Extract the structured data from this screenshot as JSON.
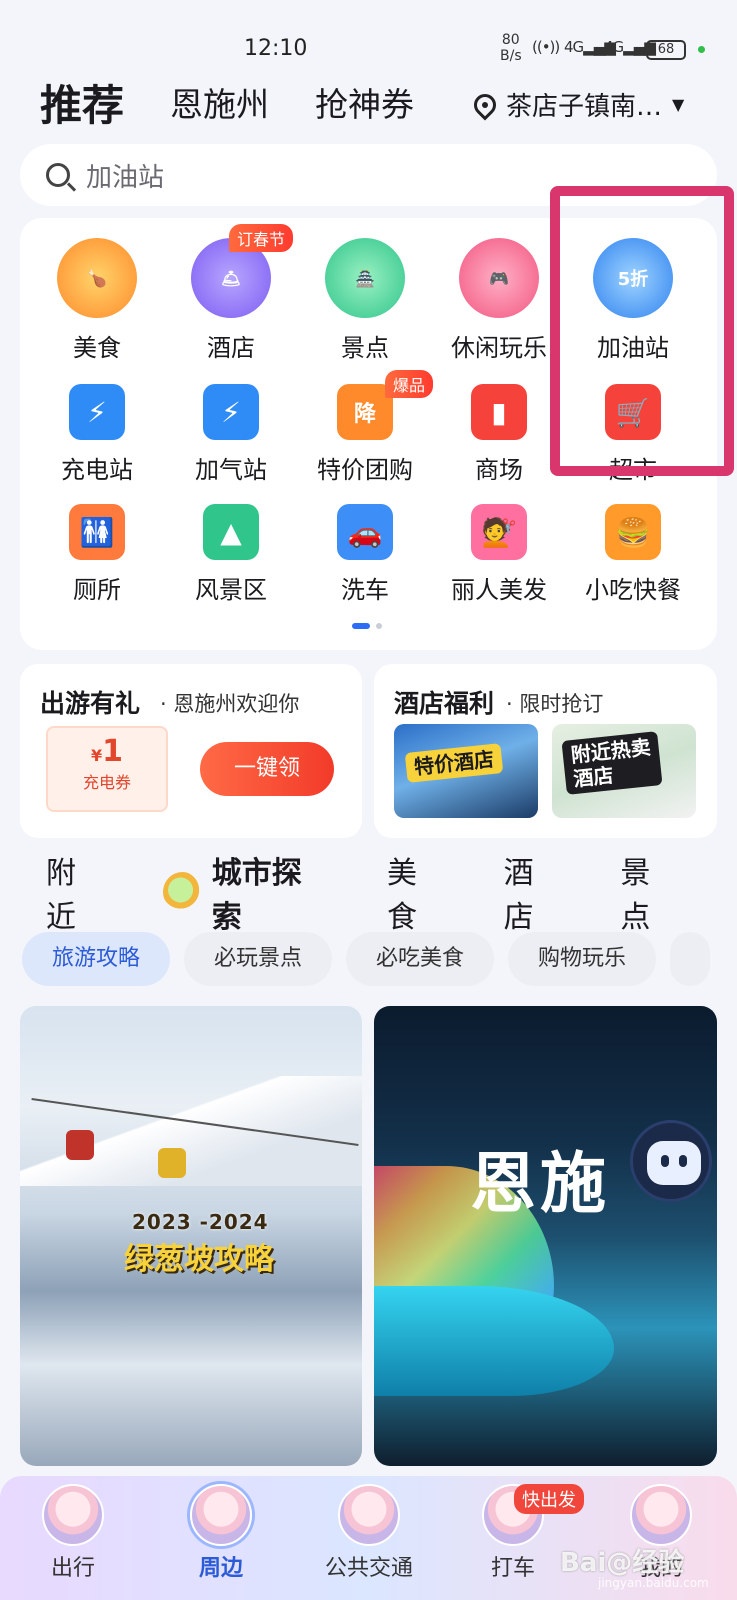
{
  "status_bar": {
    "time": "12:10",
    "speed": "80\nB/s",
    "battery": "68",
    "signal1": "4G",
    "signal2": "4G"
  },
  "header": {
    "tabs": [
      "推荐",
      "恩施州",
      "抢神券"
    ],
    "location": "茶店子镇南…"
  },
  "search": {
    "placeholder": "加油站"
  },
  "categories": [
    {
      "label": "美食"
    },
    {
      "label": "酒店",
      "tag": "订春节"
    },
    {
      "label": "景点"
    },
    {
      "label": "休闲玩乐"
    },
    {
      "label": "加油站",
      "icon_text": "5折"
    },
    {
      "label": "充电站"
    },
    {
      "label": "加气站"
    },
    {
      "label": "特价团购",
      "tag": "爆品",
      "icon_text": "降"
    },
    {
      "label": "商场"
    },
    {
      "label": "超市"
    },
    {
      "label": "厕所"
    },
    {
      "label": "风景区"
    },
    {
      "label": "洗车"
    },
    {
      "label": "丽人美发"
    },
    {
      "label": "小吃快餐"
    }
  ],
  "promo_travel": {
    "title": "出游有礼",
    "subtitle": "· 恩施州欢迎你",
    "coupon_symbol": "¥",
    "coupon_amount": "1",
    "coupon_name": "充电券",
    "button": "一键领"
  },
  "promo_hotel": {
    "title": "酒店福利",
    "subtitle": "· 限时抢订",
    "img1": "特价酒店",
    "img2": "附近热卖\n酒店"
  },
  "section_tabs": [
    "附近",
    "城市探索",
    "美食",
    "酒店",
    "景点"
  ],
  "chips": [
    "旅游攻略",
    "必玩景点",
    "必吃美食",
    "购物玩乐"
  ],
  "feed": [
    {
      "year": "2023 -2024",
      "title": "绿葱坡攻略"
    },
    {
      "title": "恩施"
    }
  ],
  "bottom_nav": [
    "出行",
    "周边",
    "公共交通",
    "打车",
    "我的"
  ],
  "bottom_badge": "快出发",
  "watermark": "Bai@经验",
  "watermark_url": "jingyan.baidu.com",
  "colors": {
    "accent": "#2d6df6",
    "highlight": "#d9366e",
    "cta": "#f23b2a"
  }
}
